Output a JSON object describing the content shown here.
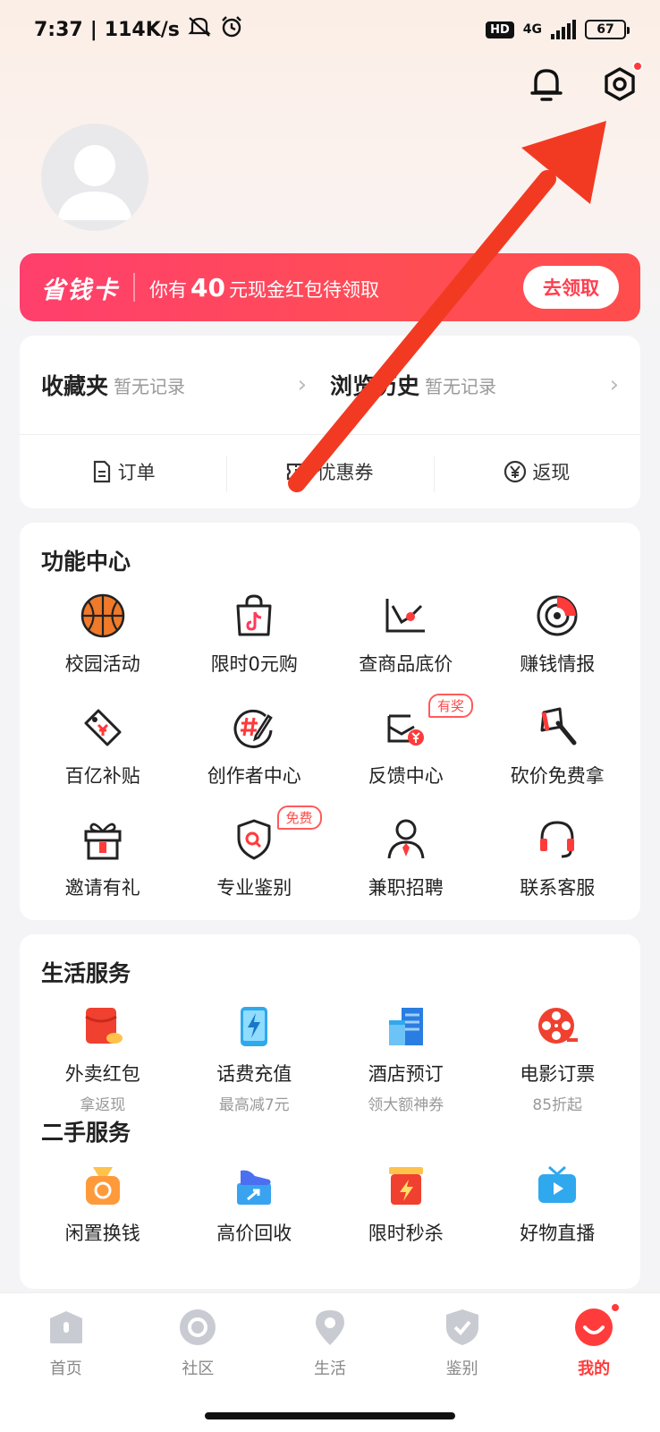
{
  "status": {
    "time": "7:37",
    "speed": "114K/s",
    "hd": "HD",
    "net": "4G",
    "battery": "67"
  },
  "save_card": {
    "brand": "省钱卡",
    "msg_prefix": "你有",
    "amount": "40",
    "msg_suffix": "元现金红包待领取",
    "button": "去领取"
  },
  "favorites": [
    {
      "title": "收藏夹",
      "sub": "暂无记录"
    },
    {
      "title": "浏览历史",
      "sub": "暂无记录"
    }
  ],
  "orders": [
    {
      "label": "订单",
      "icon": "document-icon"
    },
    {
      "label": "优惠券",
      "icon": "coupon-icon"
    },
    {
      "label": "返现",
      "icon": "yen-icon"
    }
  ],
  "function_center": {
    "title": "功能中心",
    "items": [
      {
        "label": "校园活动"
      },
      {
        "label": "限时0元购"
      },
      {
        "label": "查商品底价"
      },
      {
        "label": "赚钱情报"
      },
      {
        "label": "百亿补贴"
      },
      {
        "label": "创作者中心"
      },
      {
        "label": "反馈中心",
        "tag": "有奖"
      },
      {
        "label": "砍价免费拿"
      },
      {
        "label": "邀请有礼"
      },
      {
        "label": "专业鉴别",
        "tag": "免费"
      },
      {
        "label": "兼职招聘"
      },
      {
        "label": "联系客服"
      }
    ]
  },
  "life_services": {
    "title": "生活服务",
    "items": [
      {
        "label": "外卖红包",
        "sub": "拿返现"
      },
      {
        "label": "话费充值",
        "sub": "最高减7元"
      },
      {
        "label": "酒店预订",
        "sub": "领大额神券"
      },
      {
        "label": "电影订票",
        "sub": "85折起"
      }
    ]
  },
  "second_hand": {
    "title": "二手服务",
    "items": [
      {
        "label": "闲置换钱"
      },
      {
        "label": "高价回收"
      },
      {
        "label": "限时秒杀"
      },
      {
        "label": "好物直播"
      }
    ]
  },
  "tabs": [
    {
      "label": "首页"
    },
    {
      "label": "社区"
    },
    {
      "label": "生活"
    },
    {
      "label": "鉴别"
    },
    {
      "label": "我的"
    }
  ],
  "colors": {
    "accent": "#ff3b3b",
    "card_gradient_start": "#ff3f6c",
    "arrow": "#f23a22"
  }
}
